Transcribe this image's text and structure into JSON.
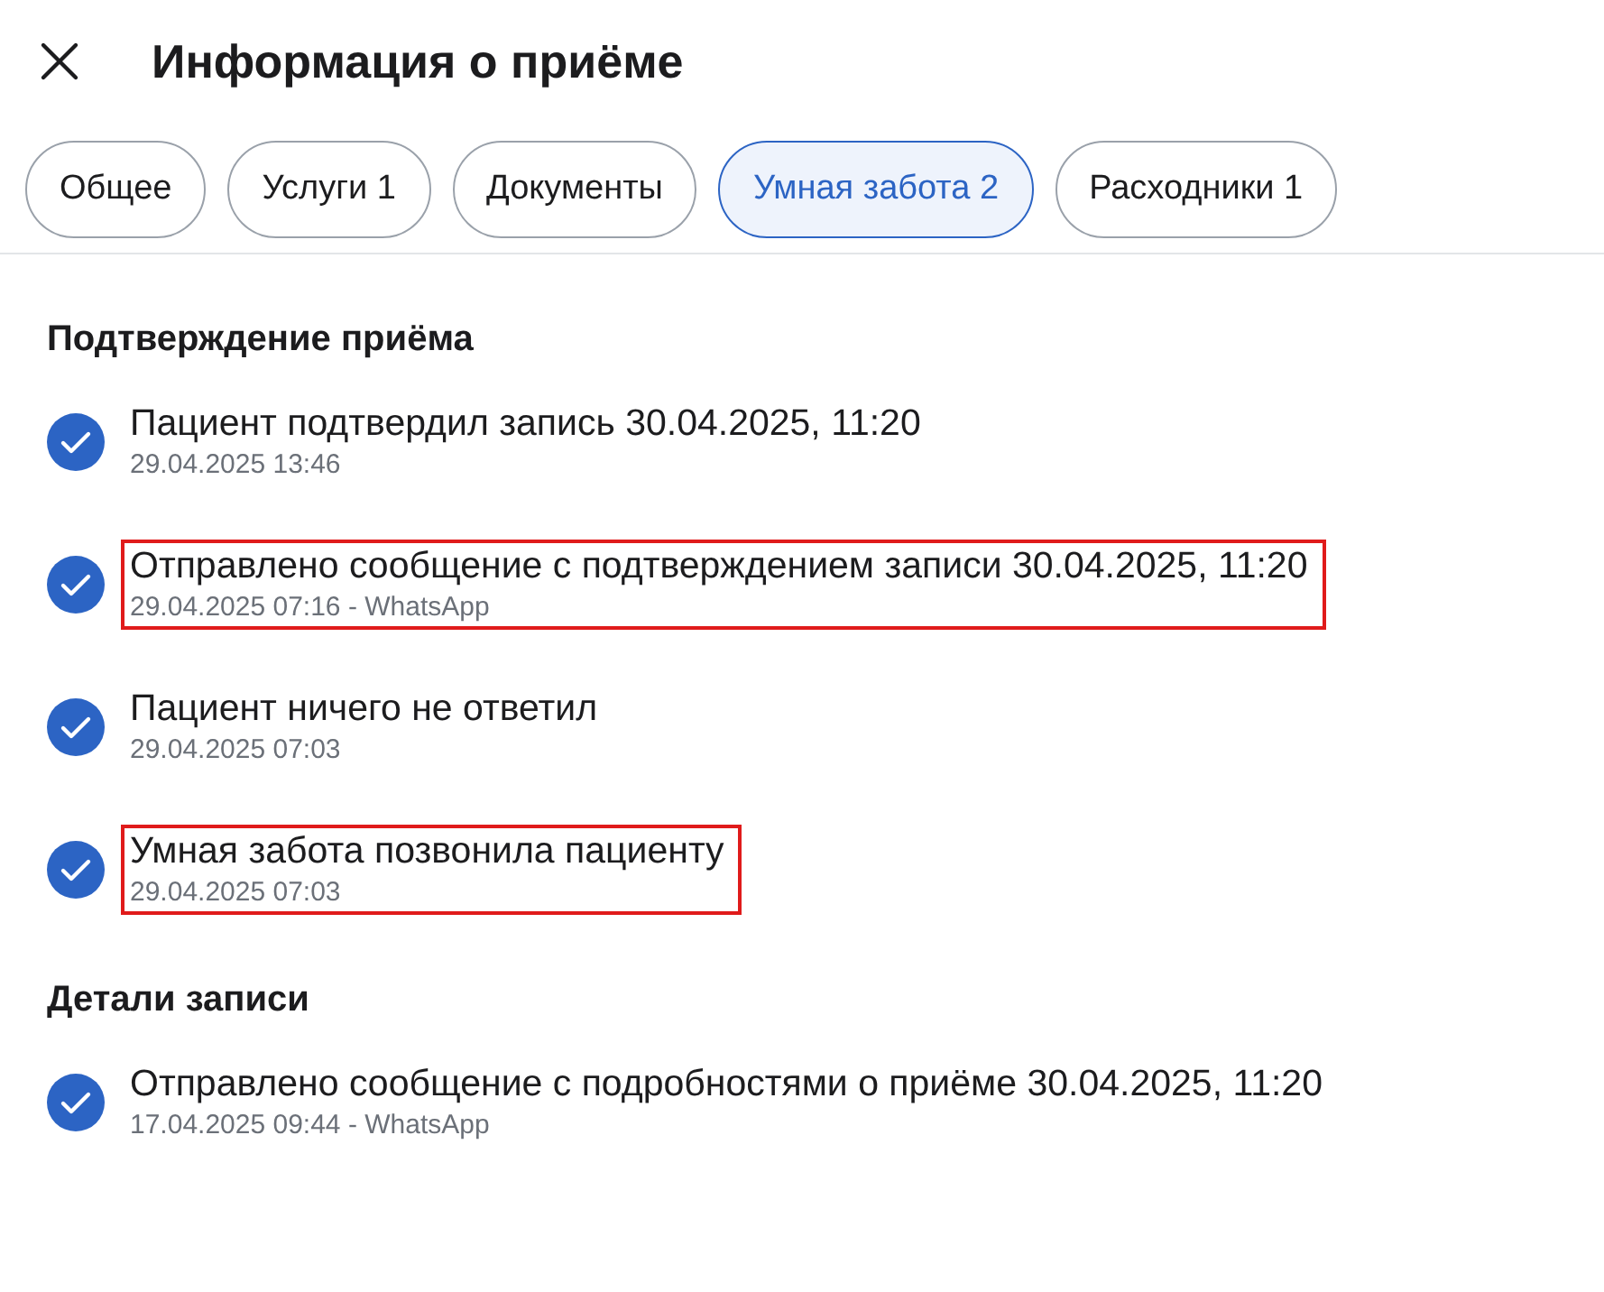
{
  "header": {
    "title": "Информация о приёме"
  },
  "tabs": [
    {
      "label": "Общее",
      "selected": false
    },
    {
      "label": "Услуги 1",
      "selected": false
    },
    {
      "label": "Документы",
      "selected": false
    },
    {
      "label": "Умная забота 2",
      "selected": true
    },
    {
      "label": "Расходники 1",
      "selected": false
    }
  ],
  "sections": [
    {
      "title": "Подтверждение приёма",
      "events": [
        {
          "text": "Пациент подтвердил запись 30.04.2025, 11:20",
          "meta": "29.04.2025 13:46",
          "highlighted": false
        },
        {
          "text": "Отправлено сообщение с подтверждением записи 30.04.2025, 11:20",
          "meta": "29.04.2025 07:16 - WhatsApp",
          "highlighted": true
        },
        {
          "text": "Пациент ничего не ответил",
          "meta": "29.04.2025 07:03",
          "highlighted": false
        },
        {
          "text": "Умная забота позвонила пациенту",
          "meta": "29.04.2025 07:03",
          "highlighted": true
        }
      ]
    },
    {
      "title": "Детали записи",
      "events": [
        {
          "text": "Отправлено сообщение с подробностями о приёме 30.04.2025, 11:20",
          "meta": "17.04.2025 09:44 - WhatsApp",
          "highlighted": false
        }
      ]
    }
  ]
}
